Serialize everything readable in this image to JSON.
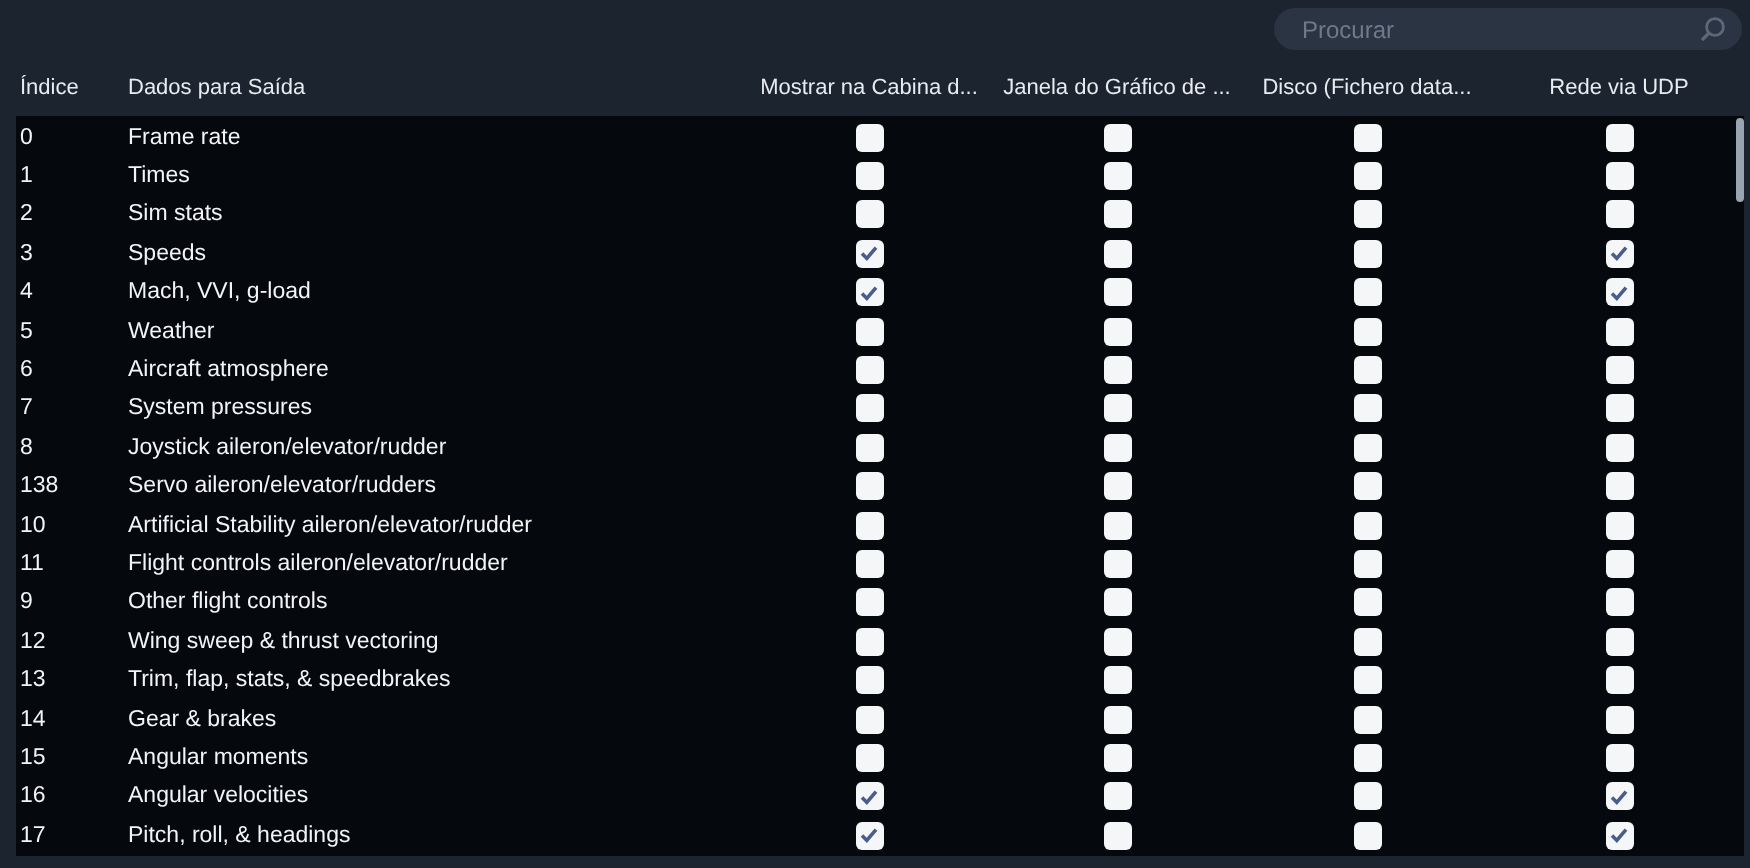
{
  "search": {
    "placeholder": "Procurar"
  },
  "table": {
    "columns": [
      "Índice",
      "Dados para Saída",
      "Mostrar na Cabina d...",
      "Janela do Gráfico de ...",
      "Disco (Fichero data...",
      "Rede via UDP"
    ],
    "rows": [
      {
        "index": "0",
        "name": "Frame rate",
        "checks": [
          false,
          false,
          false,
          false
        ]
      },
      {
        "index": "1",
        "name": "Times",
        "checks": [
          false,
          false,
          false,
          false
        ]
      },
      {
        "index": "2",
        "name": "Sim stats",
        "checks": [
          false,
          false,
          false,
          false
        ]
      },
      {
        "index": "3",
        "name": "Speeds",
        "checks": [
          true,
          false,
          false,
          true
        ]
      },
      {
        "index": "4",
        "name": "Mach, VVI, g-load",
        "checks": [
          true,
          false,
          false,
          true
        ]
      },
      {
        "index": "5",
        "name": "Weather",
        "checks": [
          false,
          false,
          false,
          false
        ]
      },
      {
        "index": "6",
        "name": "Aircraft atmosphere",
        "checks": [
          false,
          false,
          false,
          false
        ]
      },
      {
        "index": "7",
        "name": "System pressures",
        "checks": [
          false,
          false,
          false,
          false
        ]
      },
      {
        "index": "8",
        "name": "Joystick aileron/elevator/rudder",
        "checks": [
          false,
          false,
          false,
          false
        ]
      },
      {
        "index": "138",
        "name": "Servo aileron/elevator/rudders",
        "checks": [
          false,
          false,
          false,
          false
        ]
      },
      {
        "index": "10",
        "name": "Artificial Stability aileron/elevator/rudder",
        "checks": [
          false,
          false,
          false,
          false
        ]
      },
      {
        "index": "11",
        "name": "Flight controls aileron/elevator/rudder",
        "checks": [
          false,
          false,
          false,
          false
        ]
      },
      {
        "index": "9",
        "name": "Other flight controls",
        "checks": [
          false,
          false,
          false,
          false
        ]
      },
      {
        "index": "12",
        "name": "Wing sweep & thrust vectoring",
        "checks": [
          false,
          false,
          false,
          false
        ]
      },
      {
        "index": "13",
        "name": "Trim, flap, stats, & speedbrakes",
        "checks": [
          false,
          false,
          false,
          false
        ]
      },
      {
        "index": "14",
        "name": "Gear & brakes",
        "checks": [
          false,
          false,
          false,
          false
        ]
      },
      {
        "index": "15",
        "name": "Angular moments",
        "checks": [
          false,
          false,
          false,
          false
        ]
      },
      {
        "index": "16",
        "name": "Angular velocities",
        "checks": [
          true,
          false,
          false,
          true
        ]
      },
      {
        "index": "17",
        "name": "Pitch, roll, & headings",
        "checks": [
          true,
          false,
          false,
          true
        ]
      }
    ]
  }
}
